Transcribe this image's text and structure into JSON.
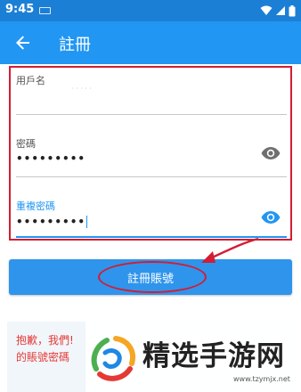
{
  "status_bar": {
    "time": "9:45",
    "icons": [
      "keyboard-icon",
      "wifi-icon",
      "signal-icon",
      "battery-icon"
    ]
  },
  "app_bar": {
    "back_icon": "arrow-left-icon",
    "title": "註冊"
  },
  "form": {
    "username": {
      "label": "用戶名",
      "value": "",
      "placeholder": "· · · · ·"
    },
    "password": {
      "label": "密碼",
      "value": "•••••••••",
      "visibility_icon": "eye-icon"
    },
    "confirm_password": {
      "label": "重複密碼",
      "value": "•••••••••",
      "visibility_icon": "eye-icon"
    }
  },
  "register_button": {
    "label": "註冊賬號"
  },
  "error": {
    "line1": "抱歉，我們!",
    "line2": "的賬號密碼"
  },
  "watermark": {
    "name": "精选手游网",
    "url": "www.tzymjx.net"
  },
  "colors": {
    "status_bar": "#1c7fd6",
    "app_bar": "#2196f3",
    "accent": "#2196f3",
    "button": "#2f94ec",
    "error_text": "#e53935",
    "annotation": "#d21d33"
  }
}
